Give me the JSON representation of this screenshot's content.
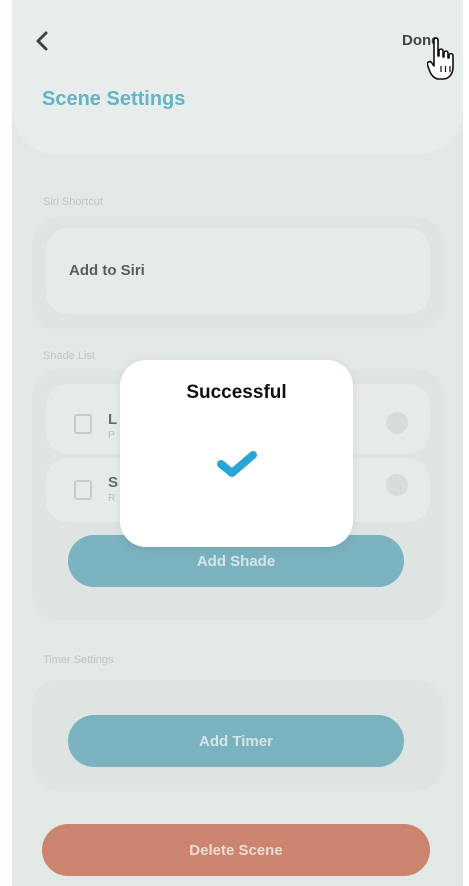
{
  "header": {
    "title": "Scene Settings",
    "done_label": "Done",
    "back_icon": "chevron-left-icon"
  },
  "siri_section": {
    "label": "Siri Shortcut",
    "add_to_siri_label": "Add to Siri"
  },
  "shade_section": {
    "label": "Shade List",
    "shades": [
      {
        "name": "L",
        "sub": "P"
      },
      {
        "name": "S",
        "sub": "R"
      }
    ],
    "add_shade_label": "Add Shade"
  },
  "timer_section": {
    "label": "Timer Settings",
    "add_timer_label": "Add Timer"
  },
  "delete_label": "Delete Scene",
  "modal": {
    "title": "Successful",
    "icon": "checkmark-icon"
  },
  "colors": {
    "accent": "#3ea7bf",
    "button": "#5ea5b9",
    "danger": "#c9684d",
    "check": "#2aa3d6"
  }
}
